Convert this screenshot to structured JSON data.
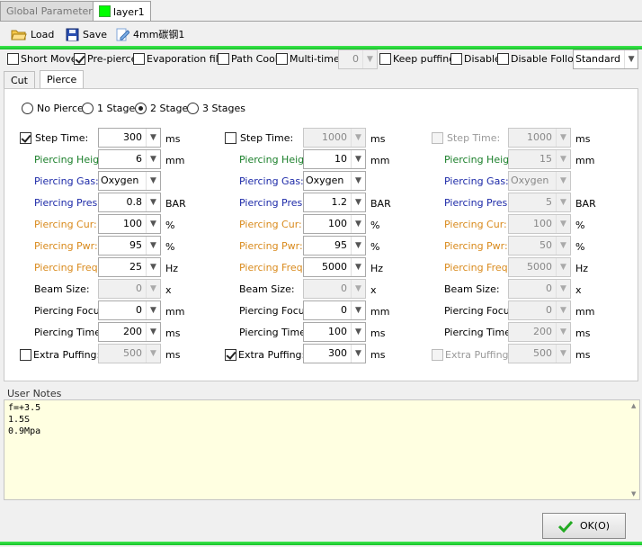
{
  "tabs": [
    {
      "label": "Global Parameter",
      "active": false
    },
    {
      "label": "layer1",
      "active": true,
      "color": "#00ff00"
    }
  ],
  "toolbar": {
    "load": "Load",
    "save": "Save",
    "process_name": "4mm碳钢1"
  },
  "options": {
    "short_move": {
      "label": "Short Move",
      "checked": false
    },
    "pre_pierce": {
      "label": "Pre-pierce",
      "checked": true
    },
    "evaporation_film": {
      "label": "Evaporation film",
      "checked": false
    },
    "path_cool": {
      "label": "Path Cool",
      "checked": false
    },
    "multi_times": {
      "label": "Multi-times",
      "checked": false,
      "value": "0"
    },
    "keep_puffing": {
      "label": "Keep puffing",
      "checked": false
    },
    "disable": {
      "label": "Disable",
      "checked": false
    },
    "disable_follow": {
      "label": "Disable Follow",
      "checked": false
    },
    "mode": "Standard"
  },
  "subtabs": [
    "Cut",
    "Pierce"
  ],
  "pierce_mode": {
    "options": [
      "No Pierce",
      "1 Stages",
      "2 Stages",
      "3 Stages"
    ],
    "selected": "2 Stages"
  },
  "labels": {
    "step_time": "Step Time:",
    "piercing_height": "Piercing Height",
    "piercing_gas": "Piercing Gas:",
    "piercing_pres": "Piercing Pres:",
    "piercing_cur": "Piercing Cur:",
    "piercing_pwr": "Piercing Pwr:",
    "piercing_freq": "Piercing Freq:",
    "beam_size": "Beam Size:",
    "piercing_focus": "Piercing Focus:",
    "piercing_time": "Piercing Time:",
    "extra_puffing": "Extra Puffing:",
    "extra_puffing_3": "Extra Puffing"
  },
  "units": {
    "ms": "ms",
    "mm": "mm",
    "bar": "BAR",
    "pct": "%",
    "hz": "Hz",
    "x": "x"
  },
  "stages": [
    {
      "step_time_checked": true,
      "step_time": "300",
      "height": "6",
      "gas": "Oxygen",
      "pres": "0.8",
      "cur": "100",
      "pwr": "95",
      "freq": "25",
      "beam": "0",
      "focus": "0",
      "time": "200",
      "extra_checked": false,
      "extra": "500"
    },
    {
      "step_time_checked": false,
      "step_time": "1000",
      "height": "10",
      "gas": "Oxygen",
      "pres": "1.2",
      "cur": "100",
      "pwr": "95",
      "freq": "5000",
      "beam": "0",
      "focus": "0",
      "time": "100",
      "extra_checked": true,
      "extra": "300"
    },
    {
      "step_time_checked": false,
      "step_time": "1000",
      "height": "15",
      "gas": "Oxygen",
      "pres": "5",
      "cur": "100",
      "pwr": "50",
      "freq": "5000",
      "beam": "0",
      "focus": "0",
      "time": "200",
      "extra_checked": false,
      "extra": "500"
    }
  ],
  "notes": {
    "label": "User Notes",
    "text": "f=+3.5\n1.5S\n0.9Mpa"
  },
  "ok_label": "OK(O)",
  "colors": {
    "accent_green": "#22cc33",
    "label_green": "#1a7f2a",
    "label_blue": "#1d2aa8",
    "label_orange": "#d98a1c",
    "notes_bg": "#ffffe1"
  }
}
